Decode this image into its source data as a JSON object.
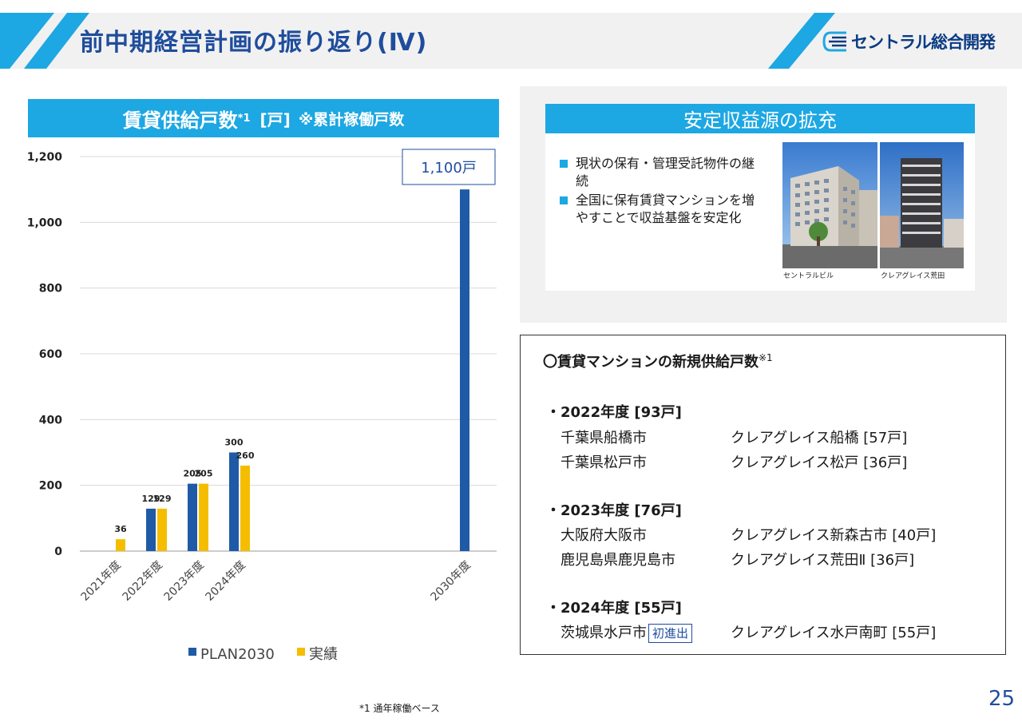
{
  "header": {
    "title": "前中期経営計画の振り返り(Ⅳ)",
    "logo_text": "セントラル総合開発"
  },
  "chart_panel": {
    "title_main": "賃貸供給戸数",
    "title_sup": "*1",
    "title_unit": "[戸]",
    "title_note": "※累計稼働戸数"
  },
  "chart_data": {
    "type": "bar",
    "categories": [
      "2021年度",
      "2022年度",
      "2023年度",
      "2024年度",
      "2030年度"
    ],
    "series": [
      {
        "name": "PLAN2030",
        "color": "#1f5aa6",
        "values": [
          null,
          129,
          205,
          300,
          1100
        ]
      },
      {
        "name": "実績",
        "color": "#f5bd00",
        "values": [
          36,
          129,
          205,
          260,
          null
        ]
      }
    ],
    "data_labels": {
      "PLAN2030": [
        "",
        "129",
        "205",
        "300",
        ""
      ],
      "実績": [
        "36",
        "129",
        "205",
        "260",
        ""
      ]
    },
    "callout": "1,100戸",
    "ylim": [
      0,
      1200
    ],
    "yticks": [
      0,
      200,
      400,
      600,
      800,
      1000,
      1200
    ],
    "ytick_labels": [
      "0",
      "200",
      "400",
      "600",
      "800",
      "1,000",
      "1,200"
    ],
    "grid": true,
    "legend_position": "bottom"
  },
  "stable_income": {
    "title": "安定収益源の拡充",
    "bullets": [
      "現状の保有・管理受託物件の継続",
      "全国に保有賃貸マンションを増やすことで収益基盤を安定化"
    ],
    "photos": [
      {
        "caption": "セントラルビル"
      },
      {
        "caption": "クレアグレイス荒田"
      }
    ]
  },
  "supply": {
    "title": "〇賃貸マンションの新規供給戸数",
    "title_sup": "※1",
    "groups": [
      {
        "year": "・2022年度 [93戸]",
        "rows": [
          {
            "city": "千葉県船橋市",
            "property": "クレアグレイス船橋 [57戸]"
          },
          {
            "city": "千葉県松戸市",
            "property": "クレアグレイス松戸 [36戸]"
          }
        ]
      },
      {
        "year": "・2023年度 [76戸]",
        "rows": [
          {
            "city": "大阪府大阪市",
            "property": "クレアグレイス新森古市 [40戸]"
          },
          {
            "city": "鹿児島県鹿児島市",
            "property": "クレアグレイス荒田Ⅱ [36戸]"
          }
        ]
      },
      {
        "year": "・2024年度 [55戸]",
        "rows": [
          {
            "city": "茨城県水戸市",
            "badge": "初進出",
            "property": "クレアグレイス水戸南町 [55戸]"
          }
        ]
      }
    ]
  },
  "footnote": "*1 通年稼働ベース",
  "page_number": "25"
}
